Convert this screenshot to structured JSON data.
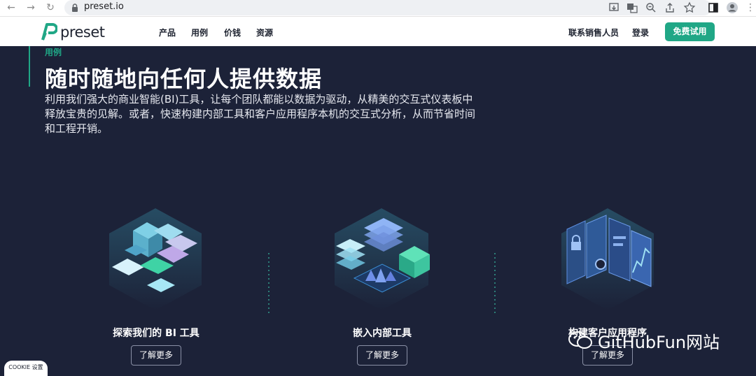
{
  "browser": {
    "url": "preset.io"
  },
  "nav": {
    "logo_text": "preset",
    "menu": [
      "产品",
      "用例",
      "价钱",
      "资源"
    ],
    "contact_label": "联系销售人员",
    "login_label": "登录",
    "cta_label": "免费试用"
  },
  "hero": {
    "eyebrow": "用例",
    "title": "随时随地向任何人提供数据",
    "description": "利用我们强大的商业智能(BI)工具，让每个团队都能以数据为驱动，从精美的交互式仪表板中释放宝贵的见解。或者，快速构建内部工具和客户应用程序本机的交互式分析，从而节省时间和工程开销。"
  },
  "cards": [
    {
      "title": "探索我们的 BI 工具",
      "button": "了解更多"
    },
    {
      "title": "嵌入内部工具",
      "button": "了解更多"
    },
    {
      "title": "构建客户应用程序",
      "button": "了解更多"
    }
  ],
  "cookie_label": "COOKIE 设置",
  "watermark_text": "GitHubFun网站",
  "colors": {
    "brand_green": "#20a786",
    "hero_bg": "#1c2238"
  }
}
